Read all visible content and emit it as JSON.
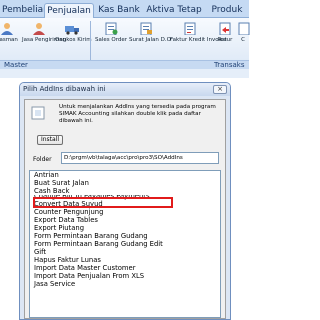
{
  "ribbon": {
    "tabs": [
      "Pembelian",
      "Penjualan",
      "Kas Bank",
      "Aktiva Tetap",
      "Produk"
    ],
    "active_tab": "Penjualan",
    "buttons": [
      {
        "label": "easman",
        "icon": "person-icon"
      },
      {
        "label": "Jasa Pengiriman",
        "icon": "person-icon"
      },
      {
        "label": "Ongkos Kirim",
        "icon": "delivery-icon"
      },
      {
        "label": "Sales Order",
        "icon": "document-icon"
      },
      {
        "label": "Surat Jalan D.O",
        "icon": "document-icon"
      },
      {
        "label": "Faktur Kredit Invoice",
        "icon": "document-icon"
      },
      {
        "label": "Retur",
        "icon": "return-icon"
      },
      {
        "label": "C",
        "icon": "document-icon"
      }
    ],
    "group_labels": {
      "master": "Master",
      "transaksi": "Transaks"
    }
  },
  "dialog": {
    "title": "Pilih AddIns dibawah ini",
    "close_label": "×",
    "info_text": "Untuk menjalankan AddIns yang tersedia pada program SIMAK Accounting silahkan double klik pada daftar dibawah ini.",
    "install_label": "Install",
    "folder_label": "Folder",
    "folder_path": "D:\\prgm\\vb\\talaga\\acc\\pro\\pro3\\SO\\AddIns",
    "items": [
      "Antrian",
      "Buat Surat Jalan",
      "Cash Back",
      "Change Bill To Payables Payments",
      "Convert Data Suyud",
      "Counter Pengunjung",
      "Export Data Tables",
      "Export Piutang",
      "Form Permintaan Barang Gudang",
      "Form Permintaan Barang Gudang Edit",
      "Gift",
      "Hapus Faktur Lunas",
      "Import Data Master Customer",
      "Import Data Penjualan From XLS",
      "Jasa Service"
    ],
    "highlighted_item": "Cash Back",
    "highlight_color": "#e11b1b"
  }
}
